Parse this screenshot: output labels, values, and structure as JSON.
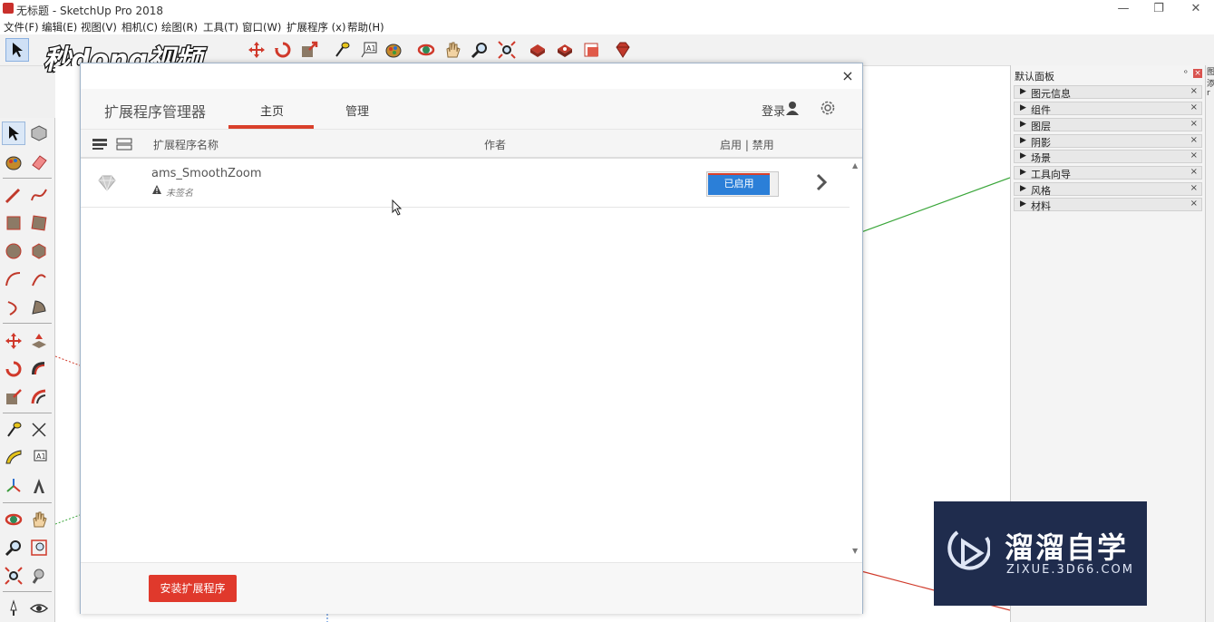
{
  "window": {
    "title": "无标题 - SketchUp Pro 2018",
    "controls": [
      "—",
      "❐",
      "✕"
    ]
  },
  "menu": [
    "文件(F)",
    "编辑(E)",
    "视图(V)",
    "相机(C)",
    "绘图(R)",
    "工具(T)",
    "窗口(W)",
    "扩展程序 (x)",
    "帮助(H)"
  ],
  "watermark_top": {
    "text": "秒dong视频"
  },
  "tray": {
    "title": "默认面板",
    "pin": "ᵒ",
    "close": "×",
    "items": [
      "图元信息",
      "组件",
      "图层",
      "阴影",
      "场景",
      "工具向导",
      "风格",
      "材料"
    ],
    "item_close": "×"
  },
  "right_strip": [
    "图",
    "添",
    "r"
  ],
  "dialog": {
    "close": "×",
    "title": "扩展程序管理器",
    "tabs": [
      "主页",
      "管理"
    ],
    "active_tab": "主页",
    "login": "登录",
    "columns": {
      "name": "扩展程序名称",
      "author": "作者",
      "enable": "启用 | 禁用"
    },
    "extensions": [
      {
        "name": "ams_SmoothZoom",
        "signature": "未签名",
        "status": "已启用"
      }
    ],
    "install_button": "安装扩展程序"
  },
  "watermark_bottom": {
    "title": "溜溜自学",
    "subtitle": "ZIXUE.3D66.COM"
  },
  "colors": {
    "accent_red": "#d9402b",
    "toggle_blue": "#2b7fd8",
    "install_red": "#e0392c",
    "wm_bg": "#1f2c4d"
  }
}
